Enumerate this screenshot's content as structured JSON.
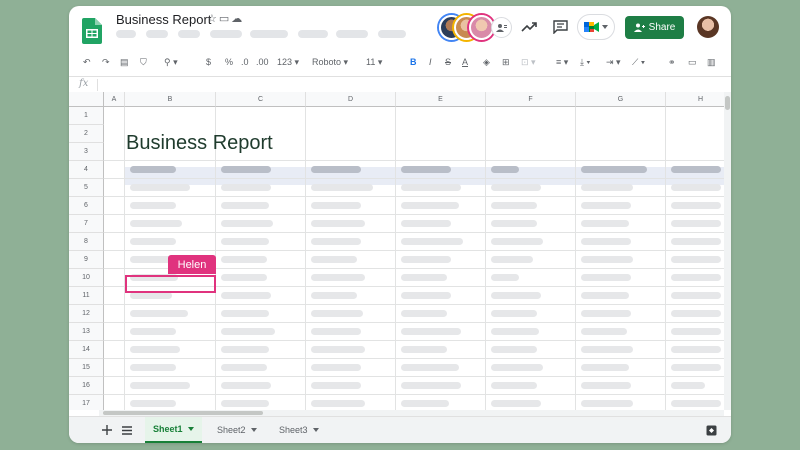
{
  "header": {
    "title": "Business Report",
    "title_icons": [
      "star-icon",
      "move-to-folder-icon",
      "cloud-saved-icon"
    ],
    "share_label": "Share",
    "collaborator_count_icon": "more-collaborators-icon"
  },
  "toolbar": {
    "font": "Roboto",
    "font_size": "11",
    "number_format": "123",
    "currency": "$",
    "percent": "%",
    "decimal_decrease": ".0",
    "decimal_increase": ".00",
    "bold": "B",
    "italic": "I",
    "strikethrough": "S",
    "text_color": "A"
  },
  "formula_bar": {
    "fx_label": "fx"
  },
  "grid": {
    "columns": [
      "A",
      "B",
      "C",
      "D",
      "E",
      "F",
      "G",
      "H"
    ],
    "rows": [
      "1",
      "2",
      "3",
      "4",
      "5",
      "6",
      "7",
      "8",
      "9",
      "10",
      "11",
      "12",
      "13",
      "14",
      "15",
      "16",
      "17"
    ],
    "sheet_title": "Business Report",
    "cursor_label": "Helen"
  },
  "tabs": {
    "sheets": [
      {
        "label": "Sheet1",
        "active": true
      },
      {
        "label": "Sheet2",
        "active": false
      },
      {
        "label": "Sheet3",
        "active": false
      }
    ]
  },
  "colors": {
    "accent_green": "#1e7e45",
    "cursor_pink": "#e0337e",
    "background": "#8fb096"
  }
}
